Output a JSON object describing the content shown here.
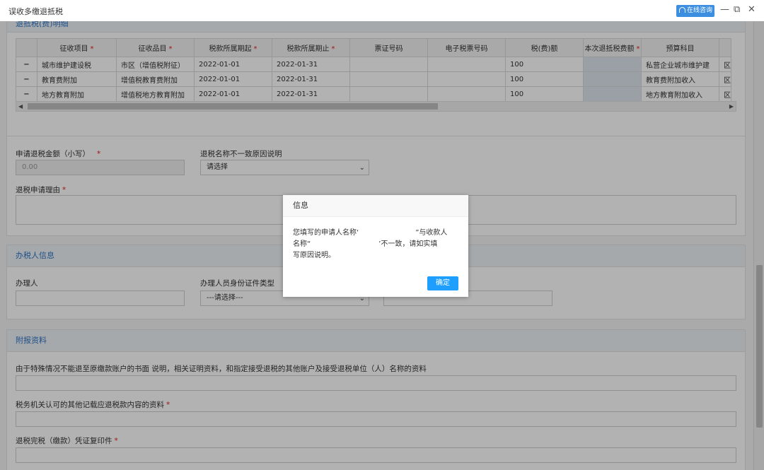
{
  "window": {
    "title": "误收多缴退抵税",
    "online_consult": "在线咨询",
    "minimize": "—",
    "maximize": "⧉",
    "close": "✕"
  },
  "detail": {
    "section_title": "退抵税(费)明细",
    "columns": [
      "",
      "征收项目",
      "征收品目",
      "税款所属期起",
      "税款所属期止",
      "票证号码",
      "电子税票号码",
      "税(费)额",
      "本次退抵税费额",
      "预算科目",
      ""
    ],
    "required_columns": [
      1,
      2,
      3,
      4,
      8
    ],
    "rows": [
      {
        "ctl": "−",
        "item": "城市维护建设税",
        "subitem": "市区（增值税附征）",
        "start": "2022-01-01",
        "end": "2022-01-31",
        "ticket": "",
        "eticket": "",
        "amount": "100",
        "refund": "",
        "budget": "私营企业城市维护建",
        "extra": "区"
      },
      {
        "ctl": "−",
        "item": "教育费附加",
        "subitem": "增值税教育费附加",
        "start": "2022-01-01",
        "end": "2022-01-31",
        "ticket": "",
        "eticket": "",
        "amount": "100",
        "refund": "",
        "budget": "教育费附加收入",
        "extra": "区"
      },
      {
        "ctl": "−",
        "item": "地方教育附加",
        "subitem": "增值税地方教育附加",
        "start": "2022-01-01",
        "end": "2022-01-31",
        "ticket": "",
        "eticket": "",
        "amount": "100",
        "refund": "",
        "budget": "地方教育附加收入",
        "extra": "区"
      }
    ],
    "scroll_left": "◀",
    "scroll_right": "▶"
  },
  "apply": {
    "amount_label": "申请退税金额（小写）",
    "amount_value": "0.00",
    "reason_mismatch_label": "退税名称不一致原因说明",
    "reason_mismatch_value": "请选择",
    "reason_label": "退税申请理由",
    "reason_value": ""
  },
  "agent": {
    "section_title": "办税人信息",
    "handler_label": "办理人",
    "handler_value": "",
    "id_type_label": "办理人员身份证件类型",
    "id_type_value": "---请选择---",
    "id_no_value": ""
  },
  "attach": {
    "section_title": "附报资料",
    "item1_label": "由于特殊情况不能退至原缴款账户的书面 说明，相关证明资料，和指定接受退税的其他账户及接受退税单位（人）名称的资料",
    "item2_label": "税务机关认可的其他记载应退税款内容的资料",
    "item3_label": "退税完税（缴款）凭证复印件"
  },
  "dialog": {
    "title": "信息",
    "line1_a": "您填写的申请人名称‘",
    "line1_b": "”与收款人",
    "line2_a": "名称“",
    "line2_b": "’不一致，请如实填",
    "line3": "写原因说明。",
    "ok": "确定"
  },
  "colors": {
    "accent": "#1e9fff",
    "section_title": "#2f75c5",
    "required": "#e02020"
  }
}
